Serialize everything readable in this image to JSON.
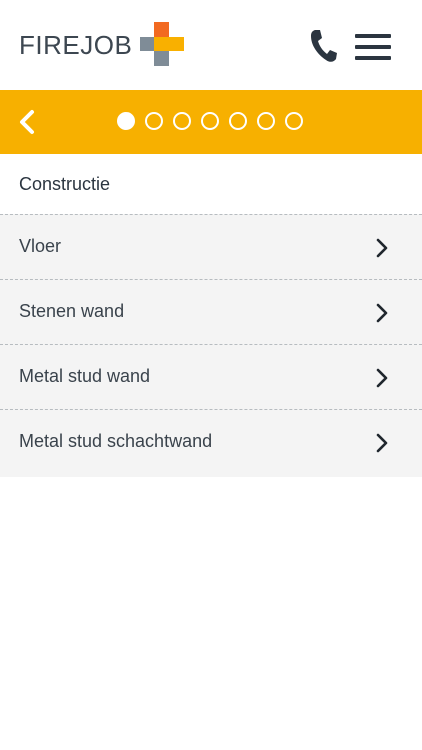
{
  "colors": {
    "accent": "#F7B000",
    "text": "#2B3540",
    "list_bg": "#F4F4F4",
    "logo_orange": "#F26A21",
    "logo_grey": "#7F8C97",
    "logo_yellow": "#F9B000"
  },
  "header": {
    "logo_text": "FIREJOB",
    "logo_icon": "firejob-cross-logo",
    "phone_icon": "phone-icon",
    "menu_icon": "hamburger-menu-icon"
  },
  "nav": {
    "back_icon": "chevron-left-icon",
    "steps_total": 7,
    "active_step": 1
  },
  "section": {
    "title": "Constructie"
  },
  "list": {
    "items": [
      {
        "label": "Vloer"
      },
      {
        "label": "Stenen wand"
      },
      {
        "label": "Metal stud wand"
      },
      {
        "label": "Metal stud schachtwand"
      }
    ],
    "chevron_icon": "chevron-right-icon"
  }
}
